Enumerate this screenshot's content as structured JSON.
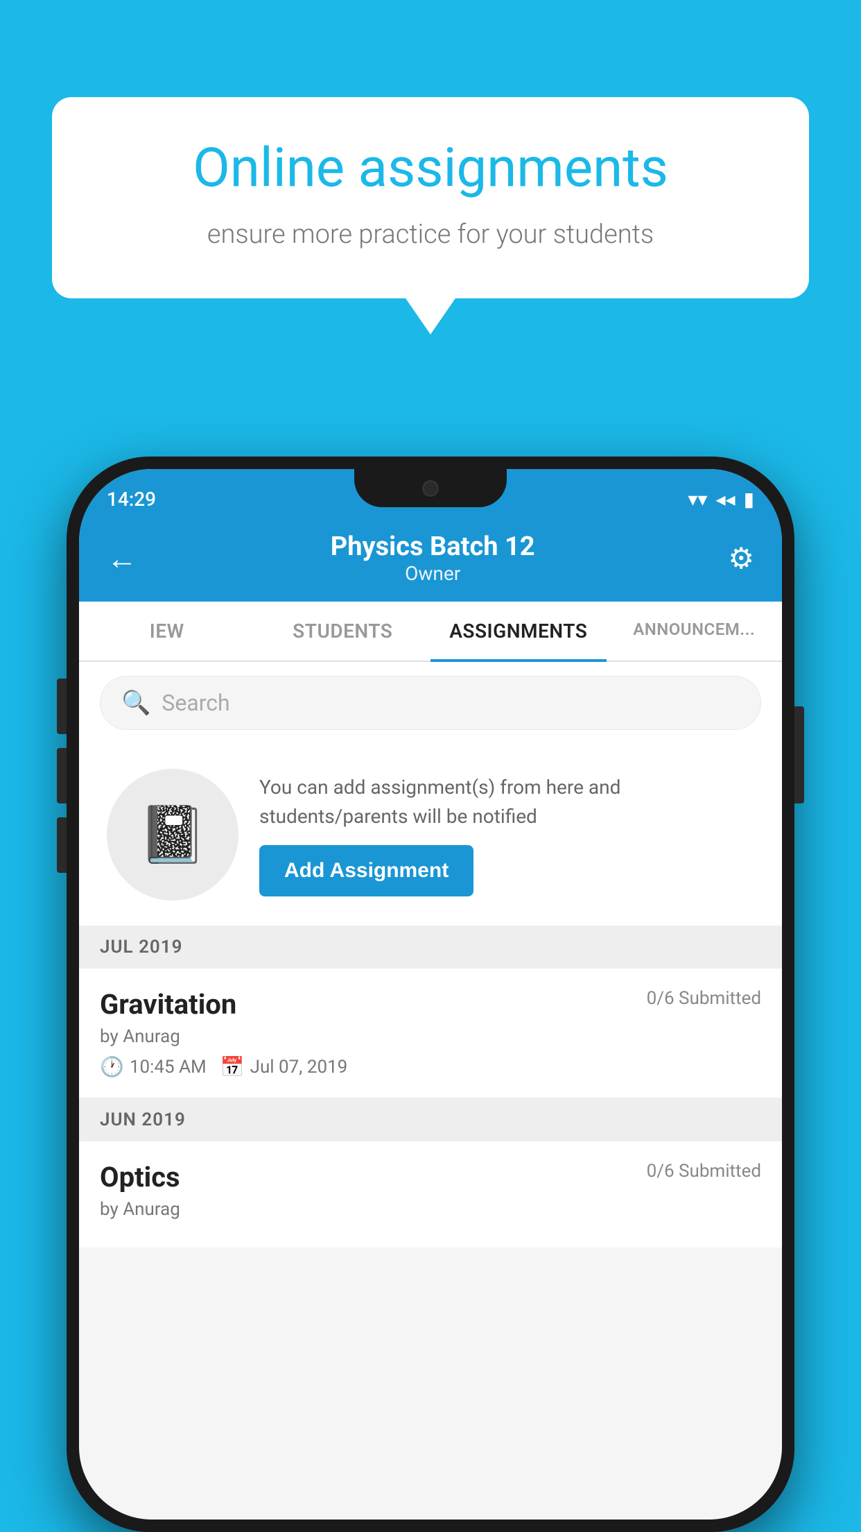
{
  "background_color": "#1BB8E8",
  "speech_bubble": {
    "title": "Online assignments",
    "subtitle": "ensure more practice for your students"
  },
  "phone": {
    "status_bar": {
      "time": "14:29",
      "wifi": "▼",
      "signal": "◀",
      "battery": "▮"
    },
    "header": {
      "title": "Physics Batch 12",
      "subtitle": "Owner",
      "back_label": "←",
      "settings_label": "⚙"
    },
    "tabs": [
      {
        "label": "IEW",
        "active": false
      },
      {
        "label": "STUDENTS",
        "active": false
      },
      {
        "label": "ASSIGNMENTS",
        "active": true
      },
      {
        "label": "ANNOUNCEM...",
        "active": false
      }
    ],
    "search": {
      "placeholder": "Search"
    },
    "empty_state": {
      "description": "You can add assignment(s) from here and students/parents will be notified",
      "button_label": "Add Assignment"
    },
    "sections": [
      {
        "label": "JUL 2019",
        "assignments": [
          {
            "name": "Gravitation",
            "submitted": "0/6 Submitted",
            "by": "by Anurag",
            "time": "10:45 AM",
            "date": "Jul 07, 2019"
          }
        ]
      },
      {
        "label": "JUN 2019",
        "assignments": [
          {
            "name": "Optics",
            "submitted": "0/6 Submitted",
            "by": "by Anurag",
            "time": "",
            "date": ""
          }
        ]
      }
    ]
  }
}
